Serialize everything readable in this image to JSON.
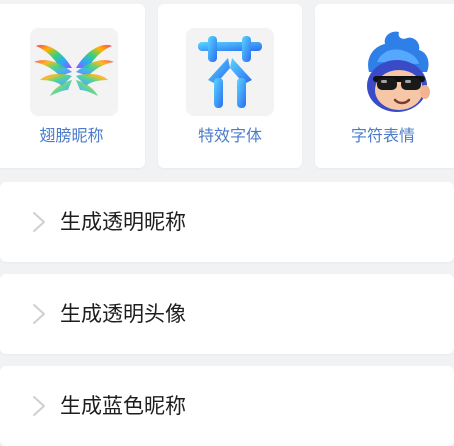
{
  "feature_cards": [
    {
      "label": "翅膀昵称",
      "icon": "rainbow-wings-icon"
    },
    {
      "label": "特效字体",
      "icon": "effect-font-icon"
    },
    {
      "label": "字符表情",
      "icon": "cool-avatar-icon"
    }
  ],
  "list": [
    {
      "label": "生成透明昵称",
      "icon": "chevron-right-icon"
    },
    {
      "label": "生成透明头像",
      "icon": "chevron-right-icon"
    },
    {
      "label": "生成蓝色昵称",
      "icon": "chevron-right-icon"
    }
  ],
  "colors": {
    "background": "#f1f2f4",
    "card": "#ffffff",
    "card_label": "#4a7cc9",
    "row_label": "#1e1e1e",
    "chevron": "#cfcfcf"
  }
}
